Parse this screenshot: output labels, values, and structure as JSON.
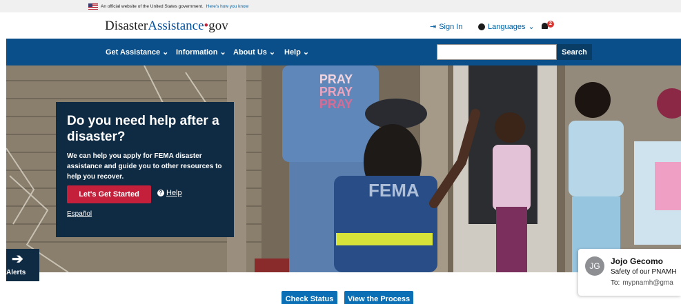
{
  "gov_banner": {
    "text": "An official website of the United States government.",
    "link": "Here's how you know"
  },
  "header": {
    "logo": {
      "part1": "Disaster",
      "part2": "Assistance",
      "part3": "gov"
    },
    "sign_in": "Sign In",
    "languages": "Languages",
    "notifications_count": "2"
  },
  "nav": {
    "items": [
      {
        "label": "Get Assistance"
      },
      {
        "label": "Information"
      },
      {
        "label": "About Us"
      },
      {
        "label": "Help"
      }
    ],
    "search_placeholder": "",
    "search_button": "Search"
  },
  "hero": {
    "title": "Do you need help after a disaster?",
    "description": "We can help you apply for FEMA disaster assistance and guide you to other resources to help you recover.",
    "cta": "Let's Get Started",
    "help": "Help",
    "espanol": "Español",
    "photo_text": {
      "shirt_line": "PRAY",
      "vest": "FEMA"
    }
  },
  "alerts": {
    "label": "Alerts"
  },
  "actions": {
    "check_status": "Check Status",
    "view_process": "View the Process"
  },
  "notification": {
    "avatar_initials": "JG",
    "from": "Jojo Gecomo",
    "subject": "Safety of our PNAMH",
    "to_label": "To:",
    "to_value": "mypnamh@gma"
  },
  "colors": {
    "nav_bg": "#0b4f8a",
    "cta_red": "#c5203b",
    "card_bg": "#0f2a43",
    "button_blue": "#0b6fb5"
  }
}
